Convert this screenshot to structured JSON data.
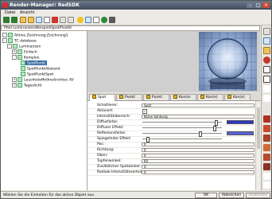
{
  "window": {
    "title": "Render-Manager: RedSDK"
  },
  "menubar": {
    "items": [
      "Datei",
      "Ansicht"
    ]
  },
  "pathbar": {
    "path": "Pfad Luminanzen/Beispiel/Spot/Punkt/"
  },
  "tree": {
    "items": [
      {
        "label": "Aktive Zeichnung:Zeichnung1",
        "level": 0,
        "expander": "-"
      },
      {
        "label": "TC database",
        "level": 0,
        "expander": "-"
      },
      {
        "label": "Luminanzen",
        "level": 1,
        "expander": "-"
      },
      {
        "label": "Einfach",
        "level": 2,
        "expander": "+"
      },
      {
        "label": "Komplex",
        "level": 2,
        "expander": "-"
      },
      {
        "label": "SpotPunkt",
        "level": 3,
        "expander": "",
        "selected": true
      },
      {
        "label": "SpotPunktAbstand",
        "level": 3,
        "expander": ""
      },
      {
        "label": "SpotPunktSpot",
        "level": 3,
        "expander": ""
      },
      {
        "label": "LeuchtstoffröhreArchitec AV",
        "level": 2,
        "expander": "+"
      },
      {
        "label": "Tageslicht",
        "level": 2,
        "expander": "+"
      }
    ]
  },
  "tabs": [
    {
      "label": "Spot",
      "active": true
    },
    {
      "label": "Punkt"
    },
    {
      "label": "Punkt"
    },
    {
      "label": "Kon(e)"
    },
    {
      "label": "Kon(e)"
    },
    {
      "label": "Kon(e)"
    }
  ],
  "properties": [
    {
      "label": "Schattierer:",
      "type": "field",
      "value": "Spot"
    },
    {
      "label": "Aktiviert:",
      "type": "check",
      "value": "✓"
    },
    {
      "label": "Intensitätsbereich:",
      "type": "field",
      "value": "Keine Senkung"
    },
    {
      "label": "Diffusfarbe:",
      "type": "color-slider",
      "slider": 0.92,
      "color": "#2b38c8"
    },
    {
      "label": "Diffuser Effekt:",
      "type": "slider",
      "slider": 0.9
    },
    {
      "label": "Reflexionsfarbe:",
      "type": "color-slider",
      "slider": 0.72,
      "color": "#5a63d8"
    },
    {
      "label": "Spiegelnder Effekt:",
      "type": "slider",
      "slider": 0.06
    },
    {
      "label": "Pos:",
      "type": "field",
      "value": "0"
    },
    {
      "label": "Richtung:",
      "type": "field",
      "value": "0"
    },
    {
      "label": "Oben:",
      "type": "field",
      "value": "0"
    },
    {
      "label": "Tupfenwinkel:",
      "type": "field",
      "value": "60"
    },
    {
      "label": "Zusätzlicher Spotwinkel:",
      "type": "field",
      "value": "0"
    },
    {
      "label": "Radiale Intensitätsverteilung:",
      "type": "field",
      "value": "0"
    }
  ],
  "status": {
    "text": "Wählen Sie die Einheiten für das aktive Objekt aus.",
    "ok": "OK",
    "cancel": "Abbrechen",
    "apply": "Anwenden"
  },
  "colors": {
    "title_bar": "#4a5566",
    "selection": "#3a6ea5",
    "accent_red": "#c84b3a"
  }
}
